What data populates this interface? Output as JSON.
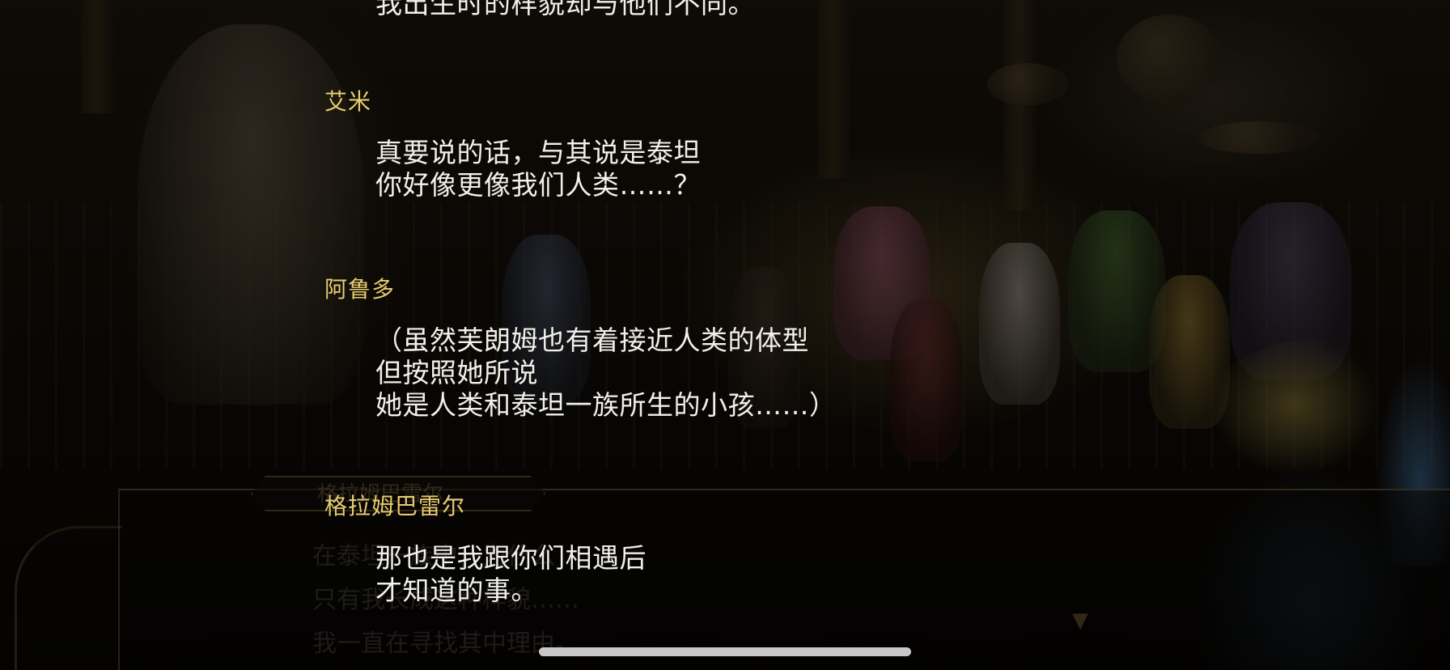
{
  "underlying_dialogue": {
    "speaker": "格拉姆巴雷尔",
    "lines": [
      "在泰坦一族中，为什么",
      "只有我长成这种样貌……",
      "我一直在寻找其中理由。"
    ]
  },
  "backlog": {
    "entries": [
      {
        "speaker": "",
        "lines": [
          "我出生时的样貌却与他们不同。"
        ]
      },
      {
        "speaker": "艾米",
        "lines": [
          "真要说的话，与其说是泰坦",
          "你好像更像我们人类……？"
        ]
      },
      {
        "speaker": "阿鲁多",
        "lines": [
          "（虽然芙朗姆也有着接近人类的体型",
          "但按照她所说",
          "她是人类和泰坦一族所生的小孩……）"
        ]
      },
      {
        "speaker": "格拉姆巴雷尔",
        "lines": [
          "那也是我跟你们相遇后",
          "才知道的事。"
        ]
      }
    ]
  },
  "colors": {
    "speaker_name": "#e7cc6f",
    "dialogue_text": "#f2f0ea"
  },
  "icons": {
    "next": "chevron-down-crest-icon"
  }
}
